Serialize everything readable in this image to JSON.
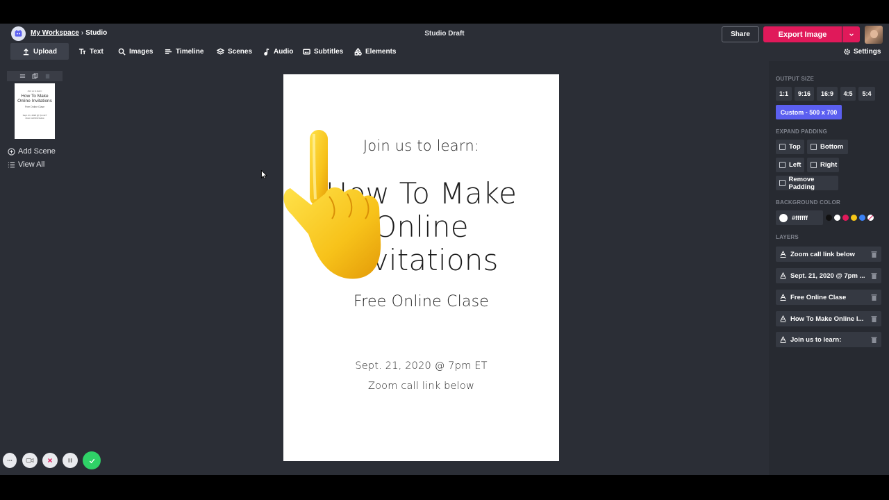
{
  "header": {
    "workspace": "My Workspace",
    "separator": "›",
    "section": "Studio",
    "doc_title": "Studio Draft",
    "share_label": "Share",
    "export_label": "Export Image",
    "settings_label": "Settings",
    "brand_color": "#e0195a"
  },
  "toolbar": {
    "upload": "Upload",
    "text": "Text",
    "images": "Images",
    "timeline": "Timeline",
    "scenes": "Scenes",
    "audio": "Audio",
    "subtitles": "Subtitles",
    "elements": "Elements",
    "active": "Upload"
  },
  "scenes": {
    "thumb": {
      "line1": "Join us to learn:",
      "line2": "How To Make Online Invitations",
      "line3": "Free Online Clase",
      "line4": "Sept. 21, 2020 @ 7pm ET",
      "line5": "Zoom call link below"
    },
    "add_scene": "Add Scene",
    "view_all": "View All"
  },
  "canvas": {
    "join": "Join us to learn:",
    "title": "How To Make Online Invitations",
    "free": "Free Online Clase",
    "date": "Sept. 21, 2020 @ 7pm ET",
    "zoom": "Zoom call link below",
    "background": "#ffffff",
    "overlay_icon": "pointing-up-hand-emoji"
  },
  "right_panel": {
    "output_size_label": "OUTPUT SIZE",
    "ratios": [
      "1:1",
      "9:16",
      "16:9",
      "4:5",
      "5:4"
    ],
    "custom_label": "Custom - 500 x 700",
    "expand_padding_label": "EXPAND PADDING",
    "padding": {
      "top": "Top",
      "bottom": "Bottom",
      "left": "Left",
      "right": "Right",
      "remove": "Remove Padding"
    },
    "background_color_label": "BACKGROUND COLOR",
    "background_hex": "#ffffff",
    "swatches": [
      "#111111",
      "#ffffff",
      "#e0195a",
      "#f5c518",
      "#3b82f6",
      "#9aa5b1"
    ],
    "layers_label": "LAYERS",
    "layers": [
      "Zoom call link below",
      "Sept. 21, 2020 @ 7pm ...",
      "Free Online Clase",
      "How To Make Online I...",
      "Join us to learn:"
    ]
  },
  "recorder": {
    "controls": [
      "more-icon",
      "camera-icon",
      "cancel-icon",
      "pause-icon",
      "done-icon"
    ]
  }
}
